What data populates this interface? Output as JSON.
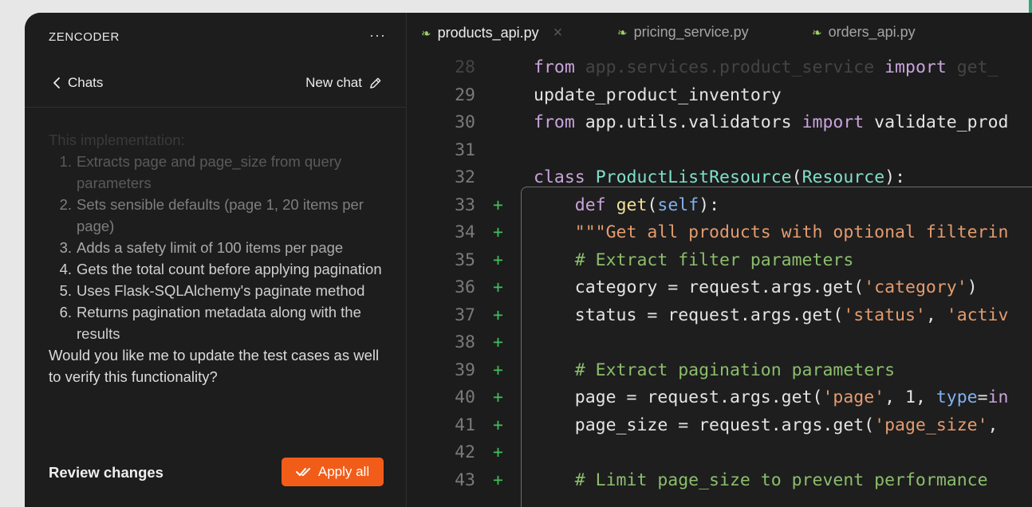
{
  "app": {
    "brand": "ZENCODER",
    "more_glyph": "···"
  },
  "chat": {
    "back_label": "Chats",
    "new_chat_label": "New chat",
    "intro": "This implementation:",
    "steps": [
      {
        "n": "1.",
        "text": "Extracts page and page_size from query parameters"
      },
      {
        "n": "2.",
        "text": "Sets sensible defaults (page 1, 20 items per page)"
      },
      {
        "n": "3.",
        "text": "Adds a safety limit of 100 items per page"
      },
      {
        "n": "4.",
        "text": "Gets the total count before applying pagination"
      },
      {
        "n": "5.",
        "text": "Uses Flask-SQLAlchemy's paginate method"
      },
      {
        "n": "6.",
        "text": "Returns pagination metadata along with the results"
      }
    ],
    "follow_up": "Would you like me to update the test cases as well to verify this functionality?",
    "review_label": "Review changes",
    "apply_label": "Apply all"
  },
  "editor": {
    "tabs": [
      {
        "label": "products_api.py",
        "active": true
      },
      {
        "label": "pricing_service.py",
        "active": false
      },
      {
        "label": "orders_api.py",
        "active": false
      }
    ],
    "lines": [
      {
        "n": "28",
        "added": false,
        "text": "from app.services.product_service import get_"
      },
      {
        "n": "29",
        "added": false,
        "text": "update_product_inventory"
      },
      {
        "n": "30",
        "added": false,
        "text": "from app.utils.validators import validate_prod"
      },
      {
        "n": "31",
        "added": false,
        "text": ""
      },
      {
        "n": "32",
        "added": false,
        "text": "class ProductListResource(Resource):"
      },
      {
        "n": "33",
        "added": true,
        "text": "    def get(self):"
      },
      {
        "n": "34",
        "added": true,
        "text": "    \"\"\"Get all products with optional filterin"
      },
      {
        "n": "35",
        "added": true,
        "text": "    # Extract filter parameters"
      },
      {
        "n": "36",
        "added": true,
        "text": "    category = request.args.get('category')"
      },
      {
        "n": "37",
        "added": true,
        "text": "    status = request.args.get('status', 'activ"
      },
      {
        "n": "38",
        "added": true,
        "text": ""
      },
      {
        "n": "39",
        "added": true,
        "text": "    # Extract pagination parameters"
      },
      {
        "n": "40",
        "added": true,
        "text": "    page = request.args.get('page', 1, type=in"
      },
      {
        "n": "41",
        "added": true,
        "text": "    page_size = request.args.get('page_size',"
      },
      {
        "n": "42",
        "added": true,
        "text": ""
      },
      {
        "n": "43",
        "added": true,
        "text": "    # Limit page_size to prevent performance"
      }
    ]
  },
  "colors": {
    "accent": "#f25c19",
    "added_marker": "#3fbf5a",
    "keyword": "#c9a4dc",
    "string": "#e49b6f",
    "comment": "#8bbe6c",
    "class_name": "#7fe0c9",
    "function_name": "#f2e19a"
  }
}
